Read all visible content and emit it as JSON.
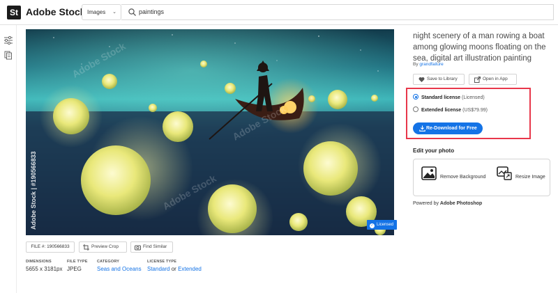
{
  "header": {
    "logo_letters": "St",
    "brand": "Adobe Stock",
    "search_type": "Images",
    "search_query": "paintings"
  },
  "image": {
    "watermark_side": "Adobe Stock | #190566833",
    "watermark_tiles": [
      "Adobe Stock",
      "Adobe Stock",
      "Adobe Stock"
    ],
    "licensed_badge": "Licensed"
  },
  "actions": {
    "file_label": "FILE #:",
    "file_number": "190566833",
    "preview_crop": "Preview Crop",
    "find_similar": "Find Similar"
  },
  "meta": {
    "dimensions_label": "DIMENSIONS",
    "dimensions_value": "5655 x 3181px",
    "filetype_label": "FILE TYPE",
    "filetype_value": "JPEG",
    "category_label": "CATEGORY",
    "category_value": "Seas and Oceans",
    "license_label": "LICENSE TYPE",
    "license_standard": "Standard",
    "license_or": "or",
    "license_extended": "Extended"
  },
  "detail": {
    "title": "night scenery of a man rowing a boat among glowing moons floating on the sea, digital art illustration painting",
    "by_label": "By",
    "author": "grandfailure",
    "save_to_library": "Save to Library",
    "open_in_app": "Open in App"
  },
  "license": {
    "standard_label": "Standard license",
    "standard_note": "(Licensed)",
    "extended_label": "Extended license",
    "extended_note": "(US$79.99)",
    "download_button": "Re-Download for Free"
  },
  "edit": {
    "section_title": "Edit your photo",
    "remove_background": "Remove Background",
    "resize_image": "Resize Image",
    "powered_by": "Powered by",
    "powered_brand": "Adobe Photoshop"
  },
  "colors": {
    "accent": "#1473e6",
    "highlight_box": "#e8374a"
  }
}
